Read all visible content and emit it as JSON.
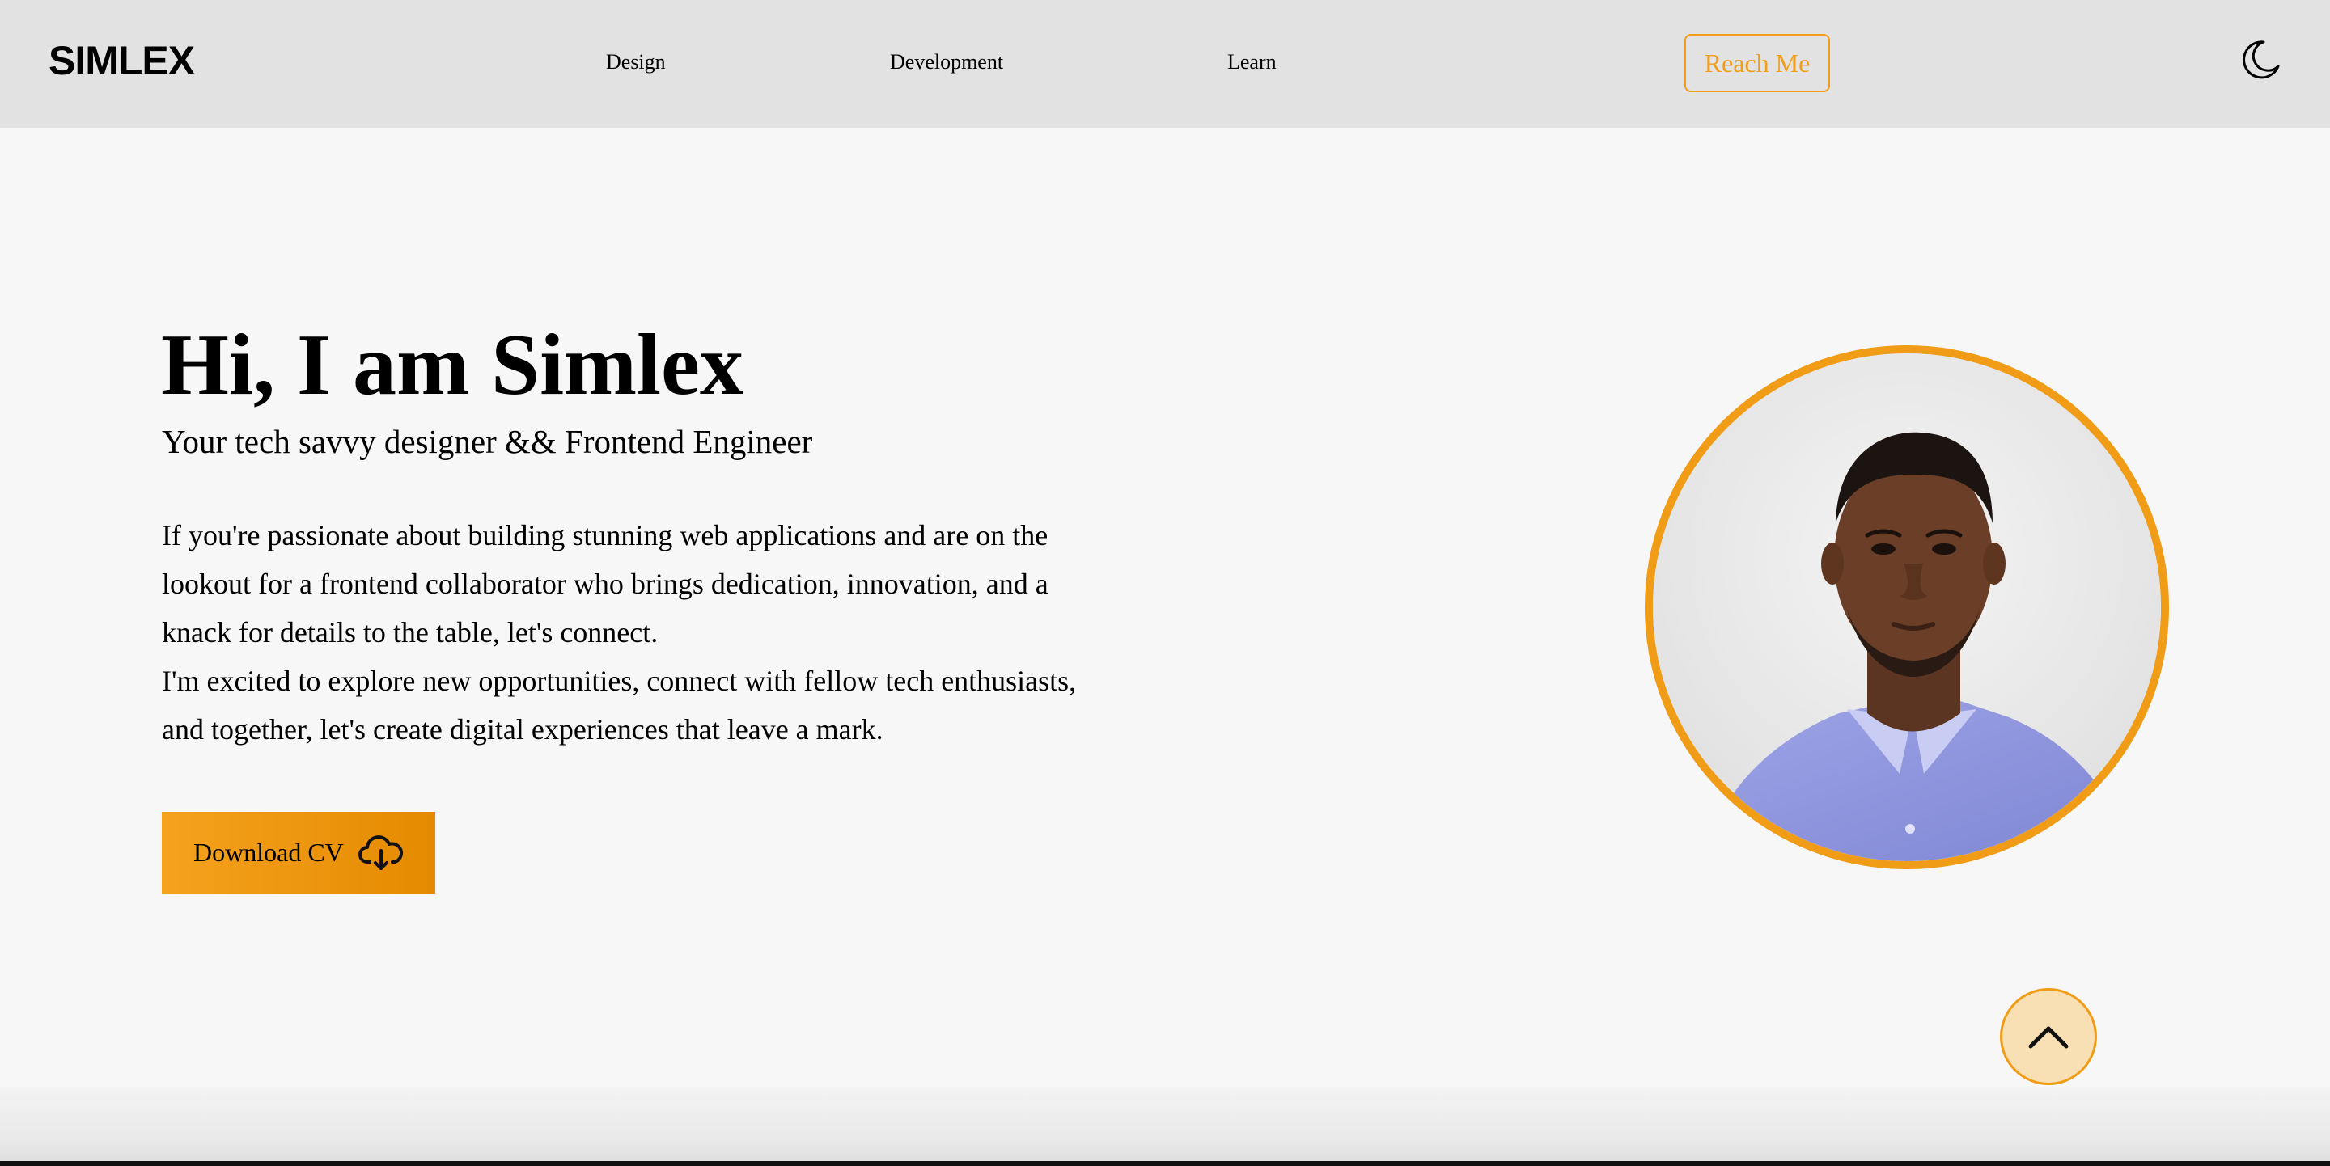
{
  "header": {
    "logo": "SIMLEX",
    "nav": {
      "design": "Design",
      "development": "Development",
      "learn": "Learn"
    },
    "reach_button": "Reach Me",
    "theme_icon": "moon-icon"
  },
  "hero": {
    "title": "Hi, I am Simlex",
    "subtitle": "Your tech savvy designer && Frontend Engineer",
    "paragraph_1": "If you're passionate about building stunning web applications and are on the lookout for a frontend collaborator who brings dedication, innovation, and a knack for details to the table, let's connect.",
    "paragraph_2": "I'm excited to explore new opportunities, connect with fellow tech enthusiasts, and together, let's create digital experiences that leave a mark.",
    "download_button": "Download CV",
    "download_icon": "cloud-download-icon"
  },
  "portrait_icon": "profile-photo",
  "scroll_top_icon": "chevron-up-icon",
  "colors": {
    "accent": "#f09c17",
    "header_bg": "#e2e2e2",
    "page_bg": "#f7f7f7",
    "scroll_button_bg": "#f8dfb4"
  }
}
